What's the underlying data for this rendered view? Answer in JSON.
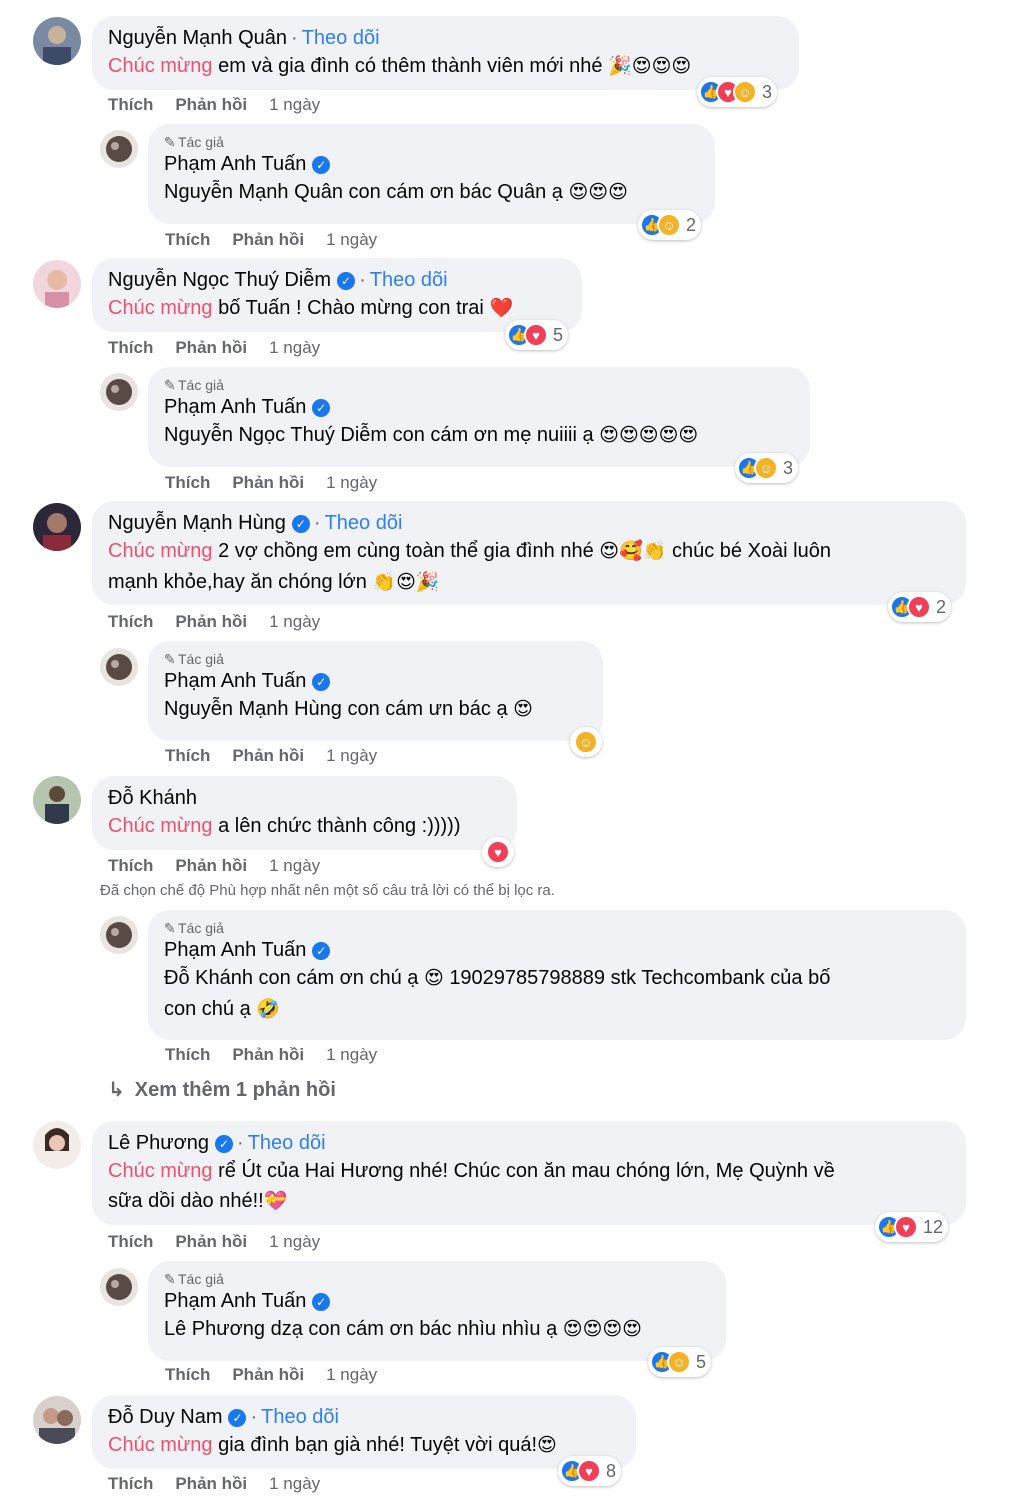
{
  "common": {
    "like": "Thích",
    "reply": "Phản hồi",
    "time": "1 ngày",
    "follow": "Theo dõi",
    "author_tag": "Tác giả",
    "highlight": "Chúc mừng"
  },
  "comments": [
    {
      "name": "Nguyễn Mạnh Quân",
      "text": "em và gia đình có thêm thành viên mới nhé",
      "emoji": "🎉😍😍😍",
      "reaction_count": "3"
    },
    {
      "name": "Phạm Anh Tuấn",
      "text": "Nguyễn Mạnh Quân con cám ơn bác Quân ạ",
      "emoji": "😍😍😍",
      "reaction_count": "2"
    },
    {
      "name": "Nguyễn Ngọc Thuý Diễm",
      "text": "bố Tuấn ! Chào mừng con trai",
      "emoji": "❤️",
      "reaction_count": "5"
    },
    {
      "name": "Phạm Anh Tuấn",
      "text": "Nguyễn Ngọc Thuý Diễm con cám ơn mẹ nuiiii ạ",
      "emoji": "😍😍😍😍😍",
      "reaction_count": "3"
    },
    {
      "name": "Nguyễn Mạnh Hùng",
      "text1": "2 vợ chồng em cùng toàn thể gia đình nhé",
      "emoji1": "😍🥰👏",
      "text1b": "chúc bé Xoài luôn",
      "text2": "mạnh khỏe,hay ăn chóng lớn",
      "emoji2": "👏😍🎉",
      "reaction_count": "2"
    },
    {
      "name": "Phạm Anh Tuấn",
      "text": "Nguyễn Mạnh Hùng con cám ưn bác ạ",
      "emoji": "😍"
    },
    {
      "name": "Đỗ Khánh",
      "text": "a lên chức thành công :)))))"
    },
    {
      "name": "Phạm Anh Tuấn",
      "text1": "Đỗ Khánh con cám ơn chú ạ",
      "emoji1": "😍",
      "text1b": "19029785798889 stk Techcombank của bố",
      "text2": "con chú ạ",
      "emoji2": "🤣"
    },
    {
      "name": "Lê Phương",
      "text1": "rể Út của Hai Hương nhé! Chúc con ăn mau chóng lớn, Mẹ Quỳnh về",
      "text2": "sữa dồi dào nhé!!",
      "emoji2": "💝",
      "reaction_count": "12"
    },
    {
      "name": "Phạm Anh Tuấn",
      "text": "Lê Phương dzạ con cám ơn bác nhìu nhìu ạ",
      "emoji": "😍😍😍😍",
      "reaction_count": "5"
    },
    {
      "name": "Đỗ Duy Nam",
      "text": "gia đình bạn già nhé! Tuyệt vời quá!",
      "emoji": "😍",
      "reaction_count": "8"
    }
  ],
  "filter_note": "Đã chọn chế độ Phù hợp nhất nên một số câu trả lời có thể bị lọc ra.",
  "view_more": "Xem thêm 1 phản hồi",
  "colors": {
    "highlight": "#f0506e",
    "follow": "#2d7ff9",
    "bubble": "#f0f2f5",
    "like": "#1877f2",
    "love": "#f33e58",
    "care": "#f7b125"
  }
}
